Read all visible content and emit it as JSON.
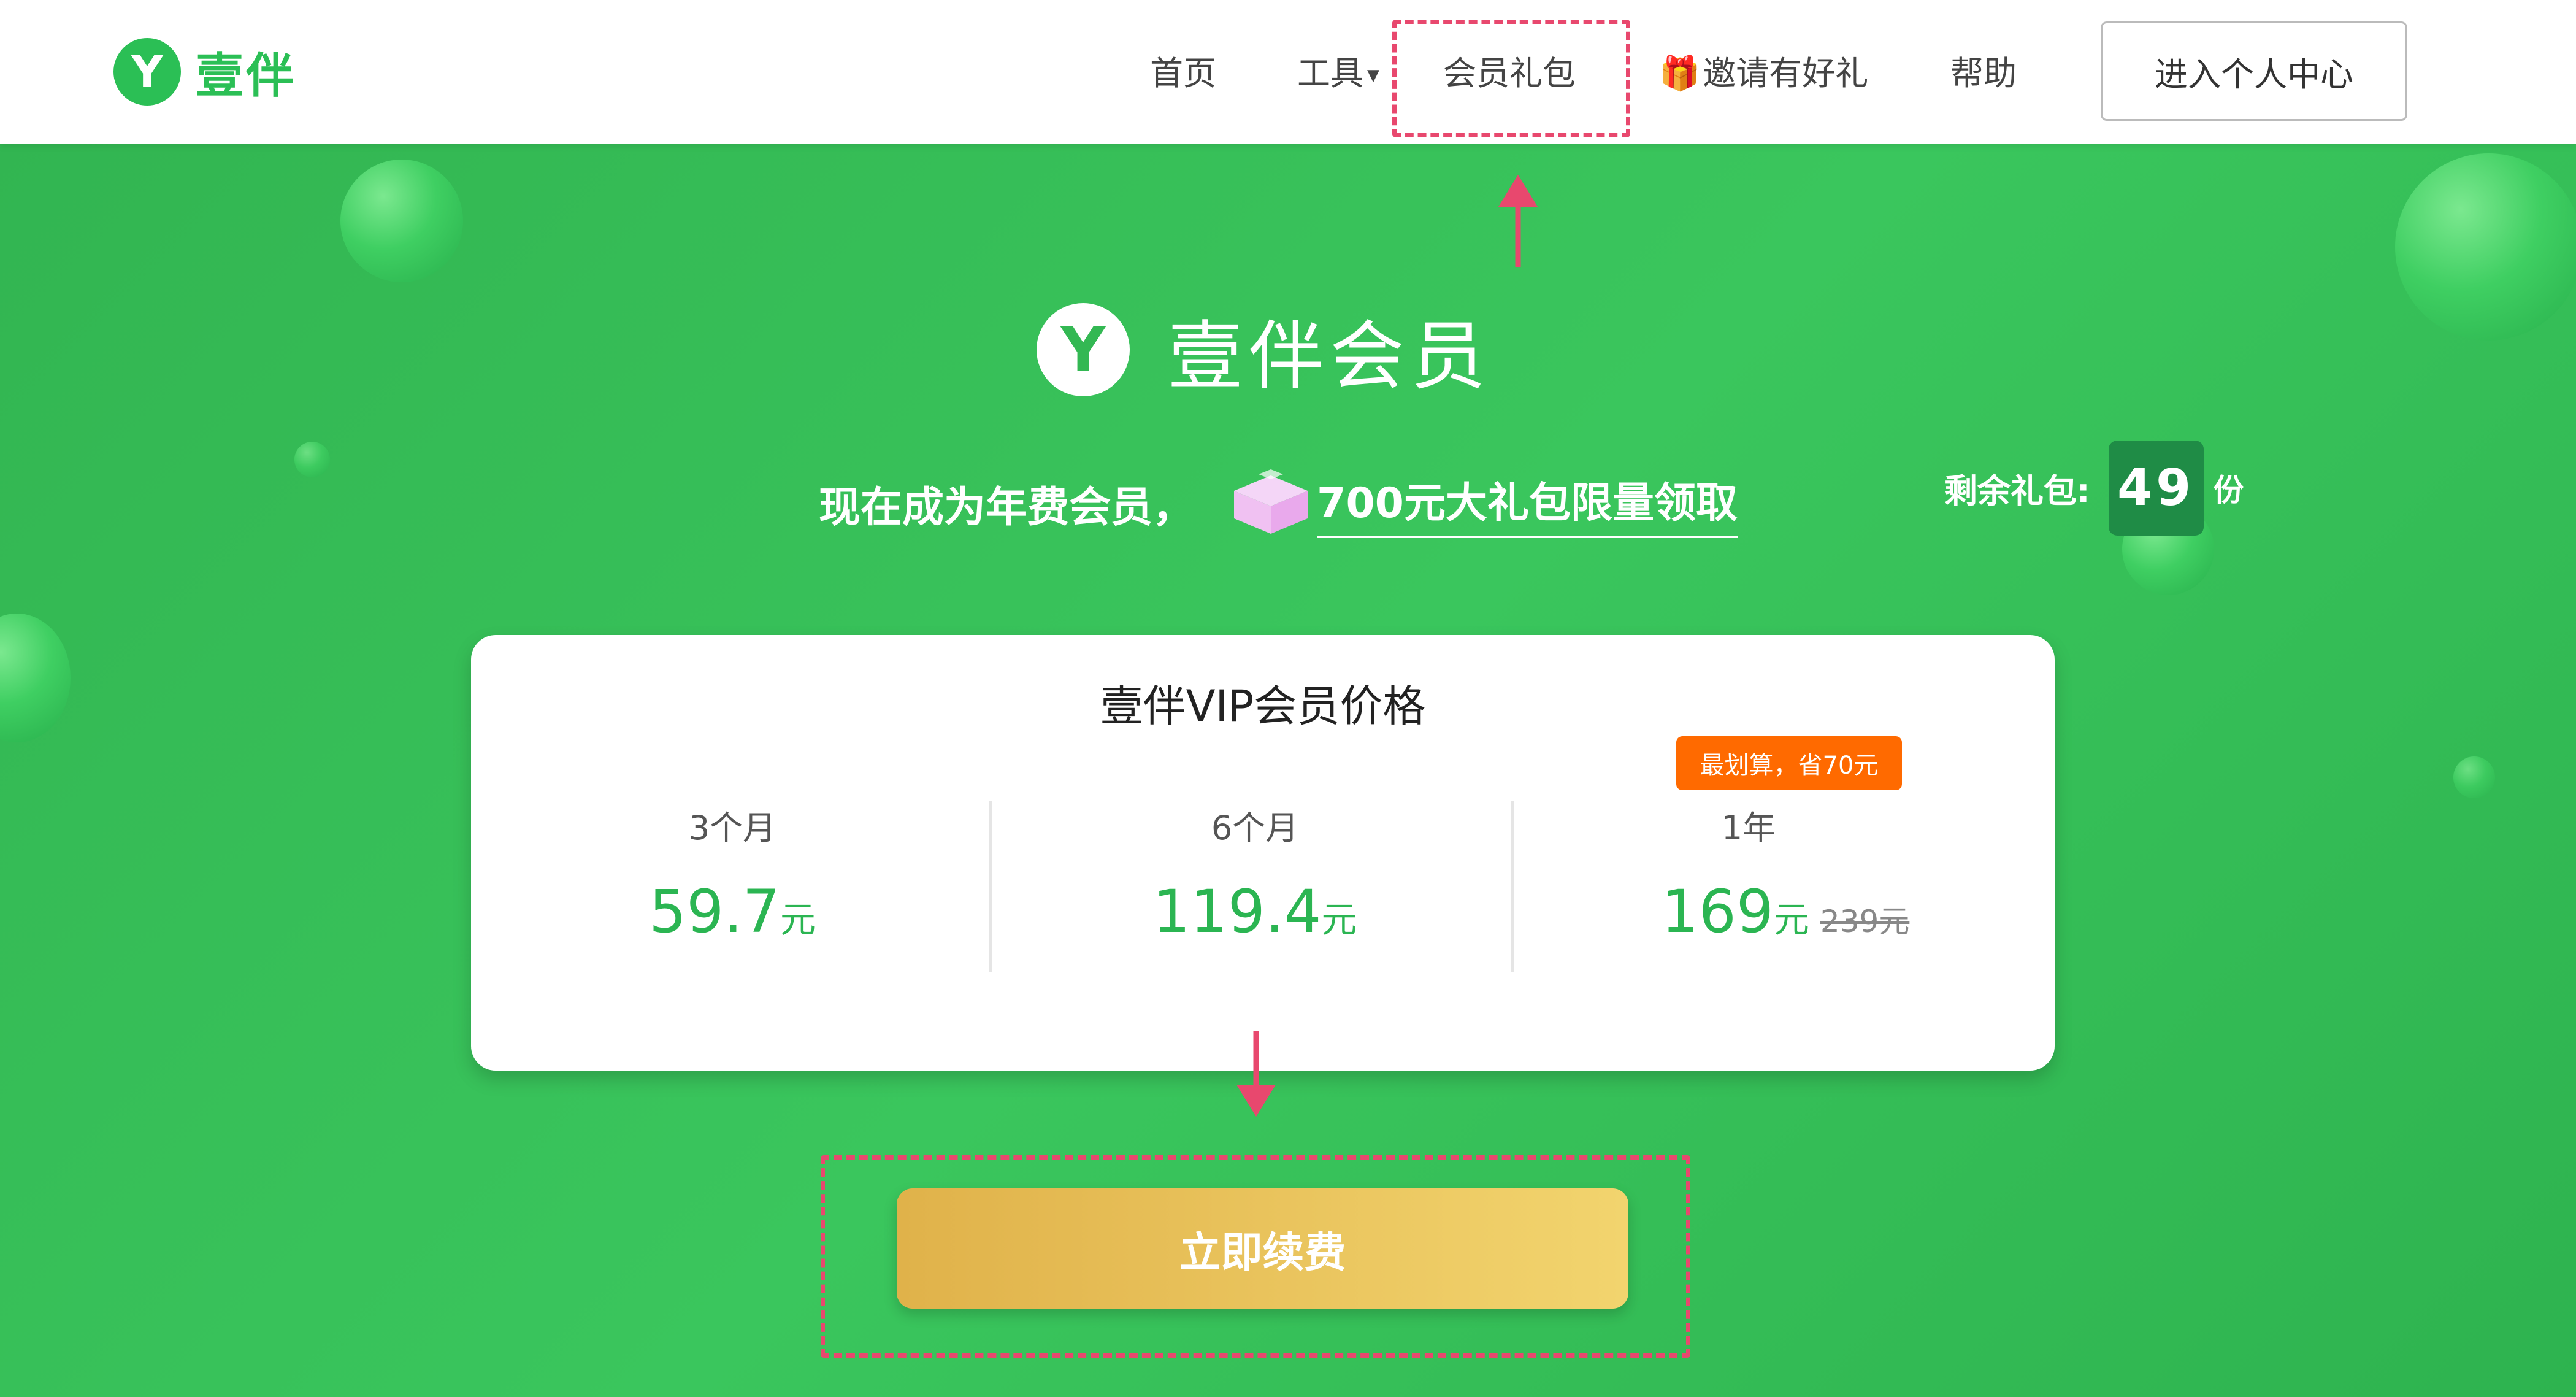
{
  "nav": {
    "brand_name": "壹伴",
    "brand_logo_letter": "Y",
    "items": [
      {
        "label": "首页"
      },
      {
        "label": "工具",
        "dropdown": true
      },
      {
        "label": "会员礼包"
      },
      {
        "label": "邀请有好礼",
        "icon": "gift-icon"
      },
      {
        "label": "帮助"
      }
    ],
    "cta_label": "进入个人中心"
  },
  "hero": {
    "title": "壹伴会员",
    "logo_letter": "Y",
    "promo_text": "现在成为年费会员，",
    "promo_link": "700元大礼包限量领取",
    "remaining_label": "剩余礼包:",
    "remaining_count": "49",
    "remaining_unit": "份"
  },
  "pricing": {
    "title": "壹伴VIP会员价格",
    "badge": "最划算，省70元",
    "plans": [
      {
        "duration": "3个月",
        "price": "59.7",
        "unit": "元"
      },
      {
        "duration": "6个月",
        "price": "119.4",
        "unit": "元"
      },
      {
        "duration": "1年",
        "price": "169",
        "unit": "元",
        "original_price": "239元"
      }
    ]
  },
  "renew_button": "立即续费",
  "colors": {
    "brand_green": "#2bbf55",
    "hero_green": "#36bd57",
    "price_green": "#2bb552",
    "badge_orange": "#ff6a00",
    "button_gold": "#e6bd55",
    "annotation_pink": "#e8486e"
  }
}
